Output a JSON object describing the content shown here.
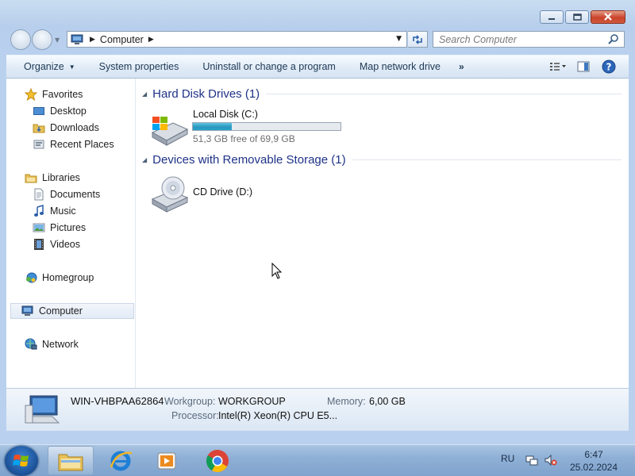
{
  "address": {
    "location": "Computer"
  },
  "search": {
    "placeholder": "Search Computer"
  },
  "toolbar": {
    "organize": "Organize",
    "system_properties": "System properties",
    "uninstall": "Uninstall or change a program",
    "map_network": "Map network drive",
    "more": "»"
  },
  "nav": {
    "favorites": "Favorites",
    "desktop": "Desktop",
    "downloads": "Downloads",
    "recent_places": "Recent Places",
    "libraries": "Libraries",
    "documents": "Documents",
    "music": "Music",
    "pictures": "Pictures",
    "videos": "Videos",
    "homegroup": "Homegroup",
    "computer": "Computer",
    "network": "Network"
  },
  "groups": {
    "hard_disks": "Hard Disk Drives (1)",
    "removable": "Devices with Removable Storage (1)"
  },
  "drives": {
    "local_disk": {
      "name": "Local Disk (C:)",
      "free_text": "51,3 GB free of 69,9 GB",
      "used_fraction": 0.266
    },
    "cd_drive": {
      "name": "CD Drive (D:)"
    }
  },
  "details": {
    "computer_name": "WIN-VHBPAA62864",
    "workgroup_label": "Workgroup:",
    "workgroup_value": "WORKGROUP",
    "memory_label": "Memory:",
    "memory_value": "6,00 GB",
    "processor_label": "Processor:",
    "processor_value": "Intel(R) Xeon(R) CPU E5..."
  },
  "taskbar": {
    "language": "RU",
    "time": "6:47",
    "date": "25.02.2024",
    "apps": [
      "windows-explorer",
      "internet-explorer",
      "media-player",
      "chrome"
    ]
  },
  "colors": {
    "group_title": "#1e3287",
    "progress_fill": "#2a97c0",
    "close_button": "#c9432b"
  }
}
